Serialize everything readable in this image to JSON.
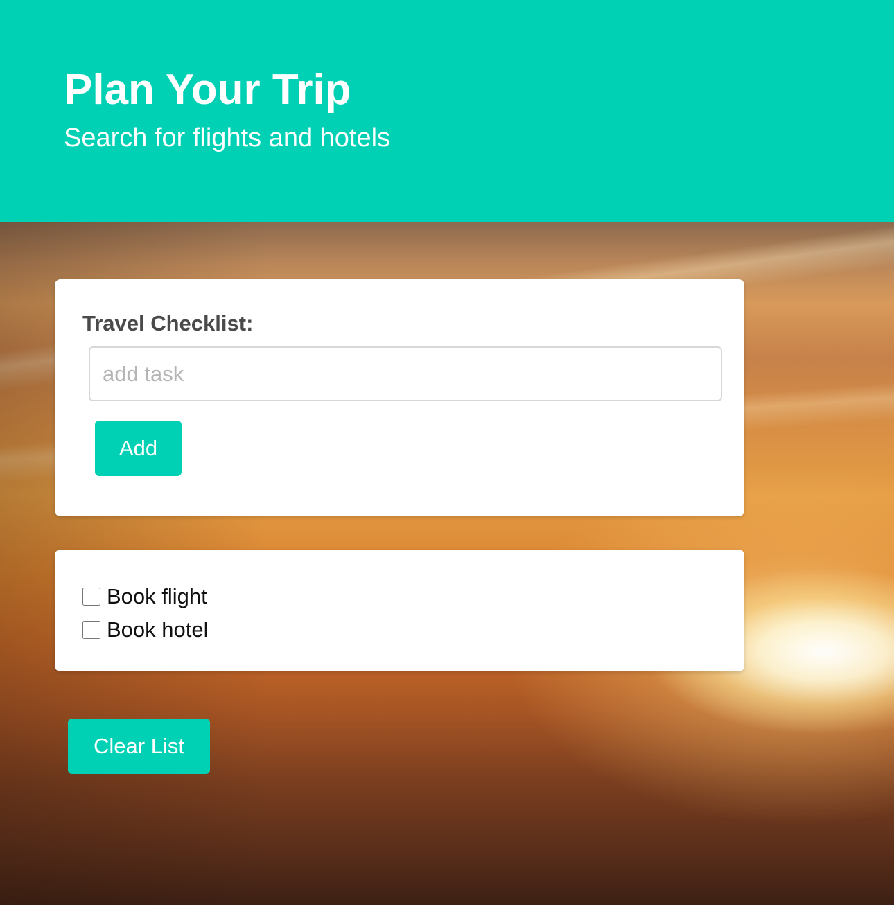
{
  "header": {
    "title": "Plan Your Trip",
    "subtitle": "Search for flights and hotels"
  },
  "form": {
    "label": "Travel Checklist:",
    "input_value": "",
    "input_placeholder": "add task",
    "add_label": "Add"
  },
  "tasks": [
    {
      "label": "Book flight",
      "checked": false
    },
    {
      "label": "Book hotel",
      "checked": false
    }
  ],
  "clear_label": "Clear List",
  "colors": {
    "accent": "#00d1b5",
    "card": "#ffffff",
    "label_text": "#4a4a4a"
  }
}
